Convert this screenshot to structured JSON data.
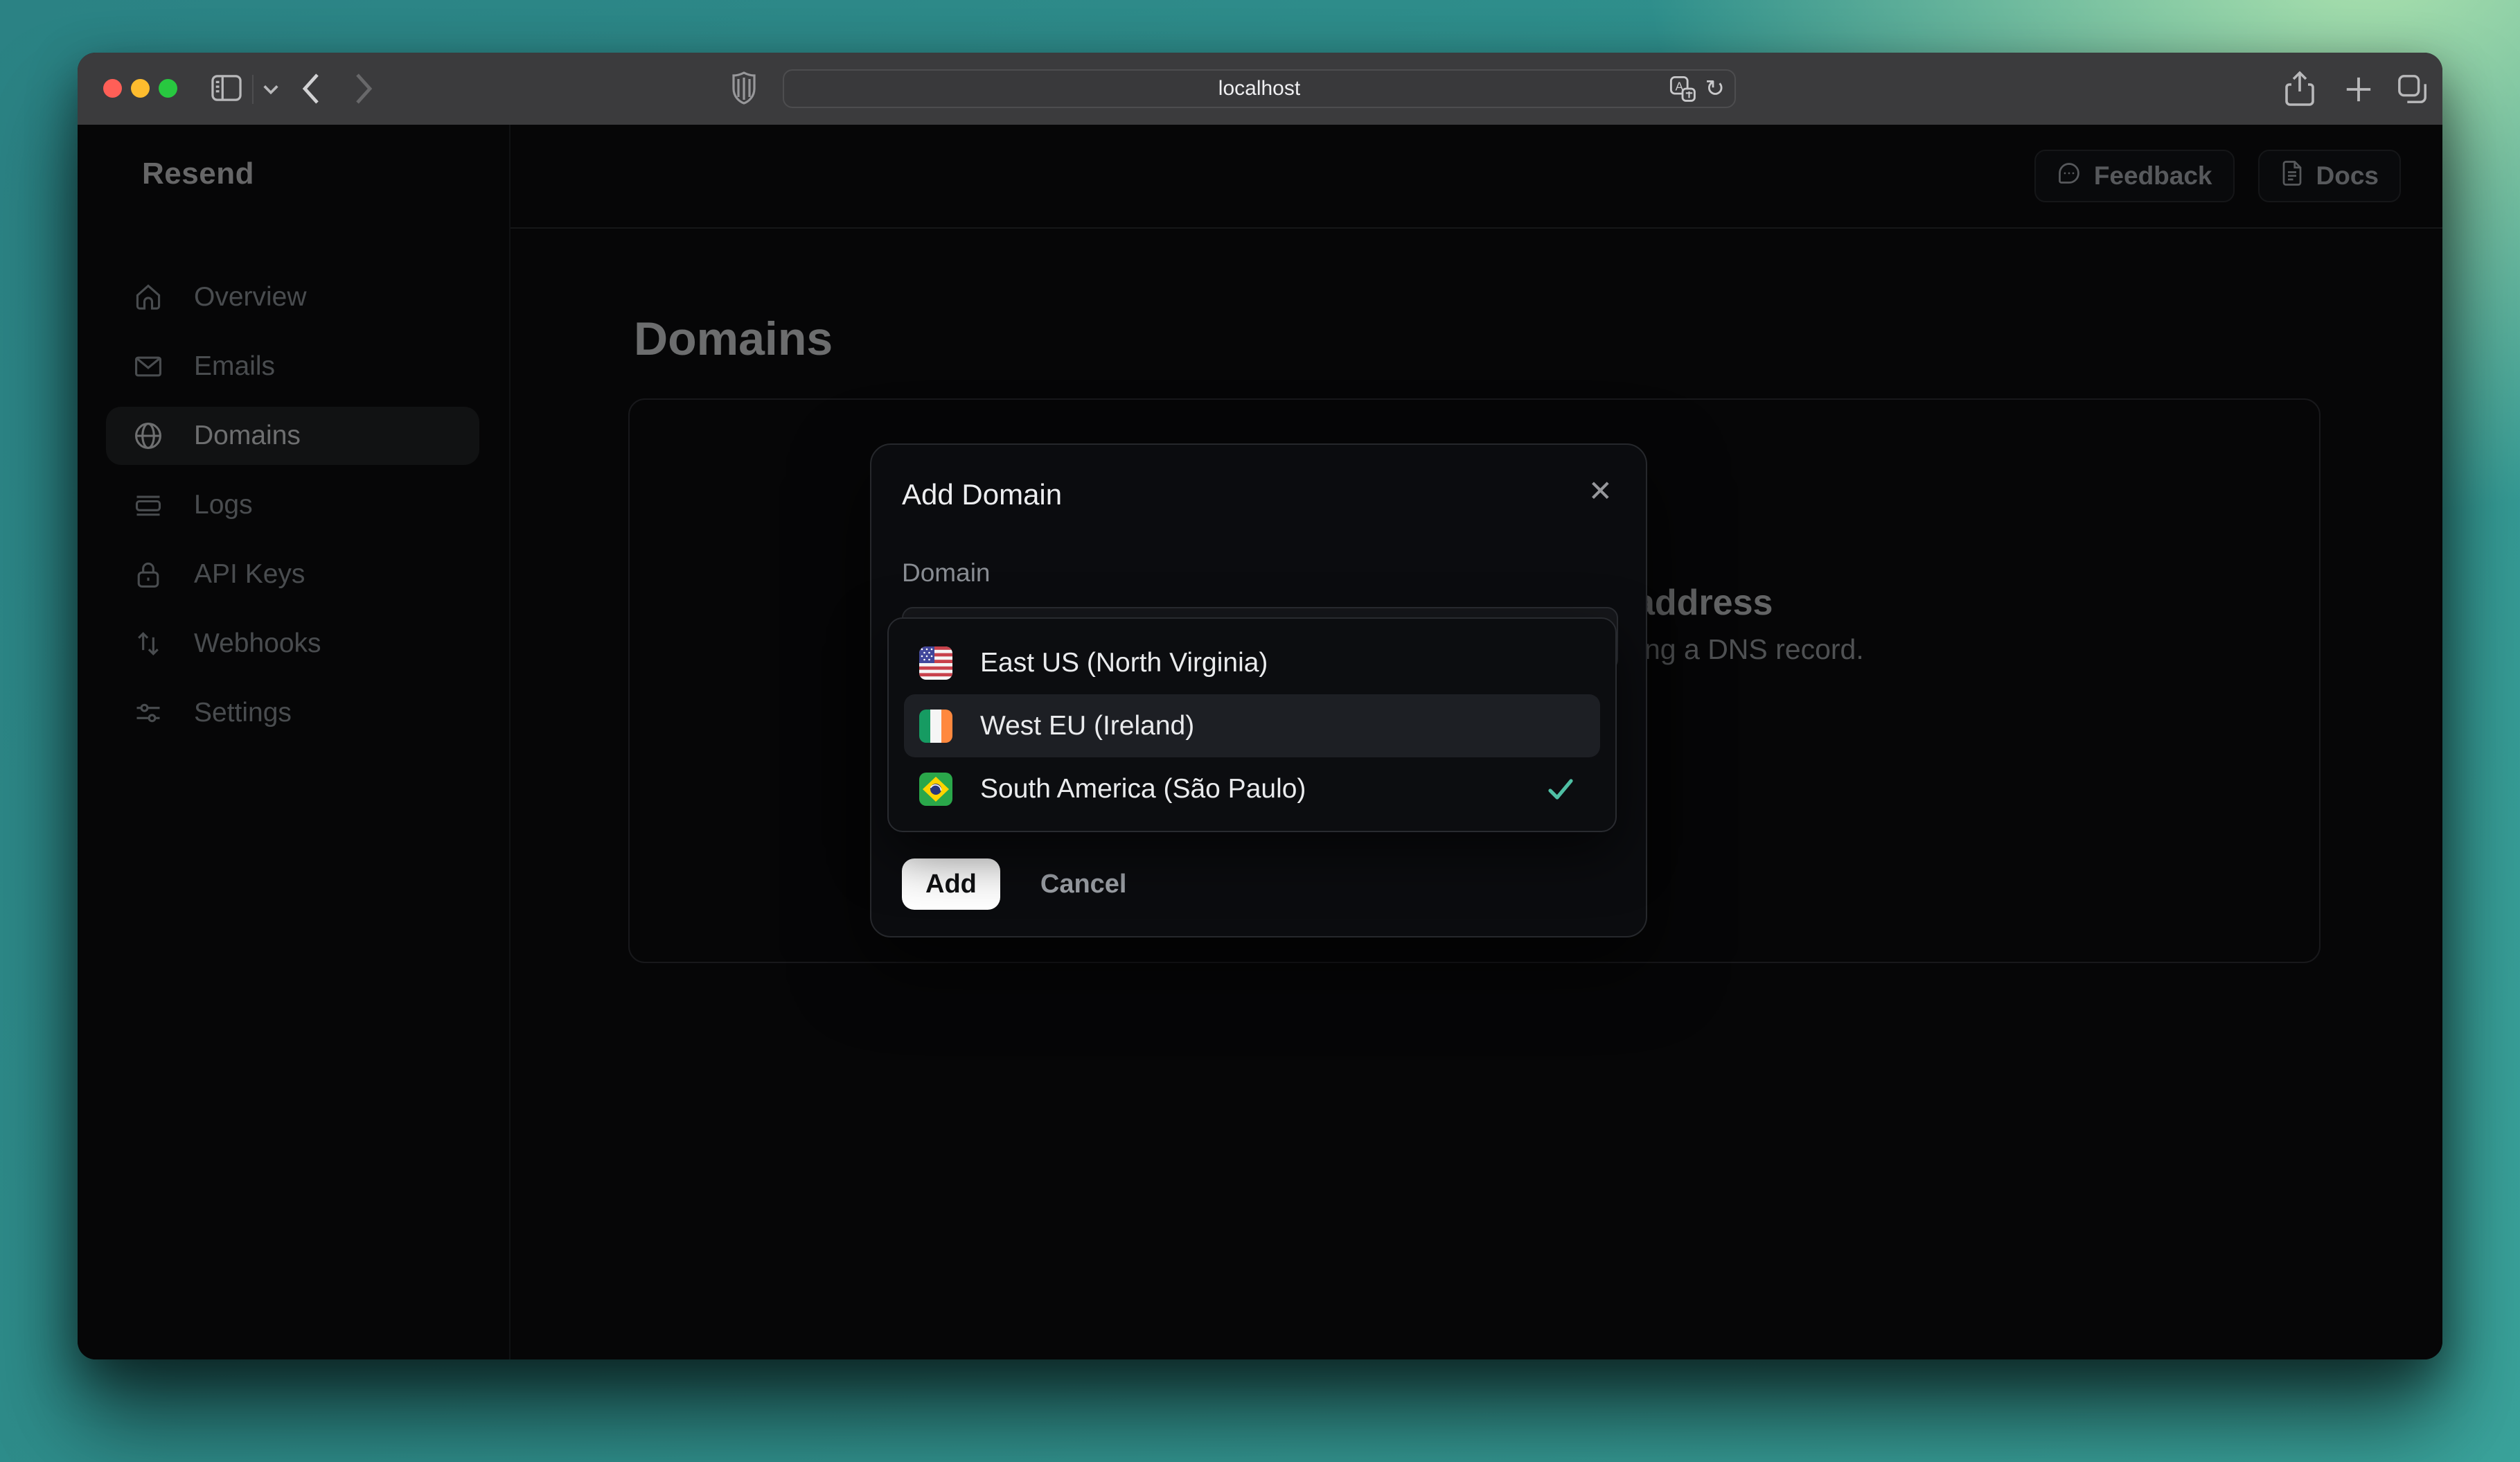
{
  "browser": {
    "url": "localhost",
    "reload_glyph": "↻"
  },
  "app": {
    "logo": "Resend",
    "sidebar": {
      "items": [
        {
          "label": "Overview",
          "icon": "home",
          "active": false
        },
        {
          "label": "Emails",
          "icon": "mail",
          "active": false
        },
        {
          "label": "Domains",
          "icon": "globe",
          "active": true
        },
        {
          "label": "Logs",
          "icon": "logs",
          "active": false
        },
        {
          "label": "API Keys",
          "icon": "lock",
          "active": false
        },
        {
          "label": "Webhooks",
          "icon": "arrows-up-down",
          "active": false
        },
        {
          "label": "Settings",
          "icon": "sliders",
          "active": false
        }
      ]
    },
    "header": {
      "feedback_label": "Feedback",
      "docs_label": "Docs"
    },
    "page": {
      "title": "Domains",
      "empty_state_heading_visible_fragment": "address",
      "empty_state_subtext_visible_fragment": "ng a DNS record."
    }
  },
  "modal": {
    "title": "Add Domain",
    "close_glyph": "✕",
    "domain_label": "Domain",
    "domain_value": "",
    "add_label": "Add",
    "cancel_label": "Cancel"
  },
  "dropdown": {
    "options": [
      {
        "label": "East US (North Virginia)",
        "flag": "us",
        "highlighted": false,
        "selected": false
      },
      {
        "label": "West EU (Ireland)",
        "flag": "ie",
        "highlighted": true,
        "selected": false
      },
      {
        "label": "South America (São Paulo)",
        "flag": "br",
        "highlighted": false,
        "selected": true
      }
    ]
  },
  "colors": {
    "selected_check": "#4fbfa4",
    "add_button_bg": "#ffffff",
    "traffic_close": "#ff5f57",
    "traffic_minimize": "#febc2e",
    "traffic_zoom": "#28c840"
  }
}
